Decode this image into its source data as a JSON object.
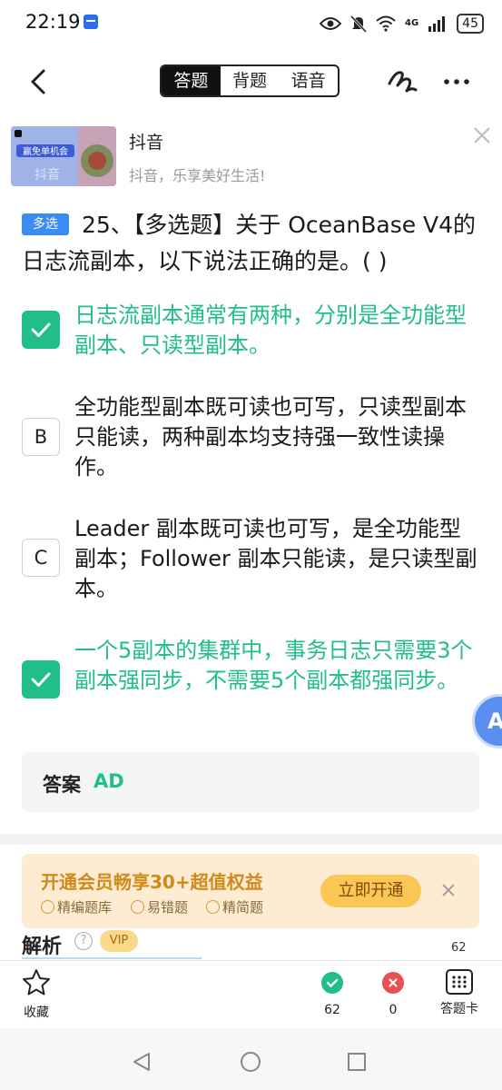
{
  "status_bar": {
    "time": "22:19",
    "network": "4G",
    "battery": "45"
  },
  "nav": {
    "tabs": [
      "答题",
      "背题",
      "语音"
    ],
    "active_tab": 0
  },
  "ad": {
    "title": "抖音",
    "subtitle": "抖音，乐享美好生活!",
    "thumb_text": "赢免单机会",
    "thumb_logo": "抖音"
  },
  "question": {
    "type_badge": "多选",
    "text": "25、【多选题】关于 OceanBase V4的日志流副本，以下说法正确的是。( )",
    "options": [
      {
        "letter": "A",
        "text": "日志流副本通常有两种，分别是全功能型副本、只读型副本。",
        "selected": true,
        "correct": true
      },
      {
        "letter": "B",
        "text": "全功能型副本既可读也可写，只读型副本只能读，两种副本均支持强一致性读操作。",
        "selected": false,
        "correct": false
      },
      {
        "letter": "C",
        "text": "Leader 副本既可读也可写，是全功能型副本；Follower 副本只能读，是只读型副本。",
        "selected": false,
        "correct": false
      },
      {
        "letter": "D",
        "text": "一个5副本的集群中，事务日志只需要3个副本强同步，不需要5个副本都强同步。",
        "selected": true,
        "correct": true
      }
    ]
  },
  "answer": {
    "label": "答案",
    "value": "AD"
  },
  "vip": {
    "title": "开通会员畅享30+超值权益",
    "features": [
      "精编题库",
      "易错题",
      "精简题"
    ],
    "button": "立即开通"
  },
  "analysis": {
    "title": "解析",
    "help": "?",
    "badge": "VIP"
  },
  "toolbar": {
    "total": "62",
    "favorite_label": "收藏",
    "correct_count": "62",
    "wrong_count": "0",
    "card_label": "答题卡"
  },
  "colors": {
    "accent_green": "#1fbf87",
    "badge_blue": "#3b8cf2",
    "vip_orange": "#d08a1a"
  }
}
